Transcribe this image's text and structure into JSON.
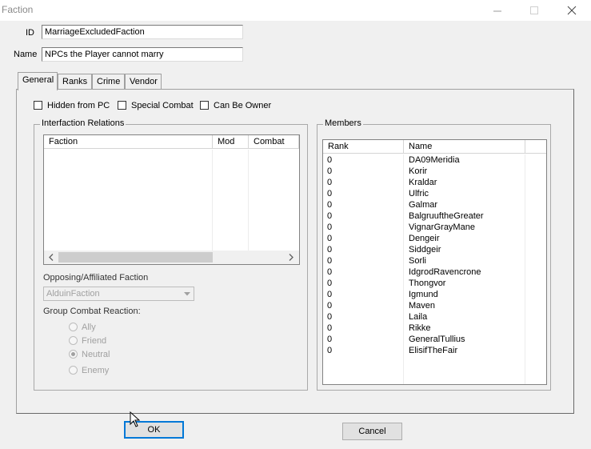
{
  "window": {
    "title": "Faction"
  },
  "fields": {
    "id_label": "ID",
    "id_value": "MarriageExcludedFaction",
    "name_label": "Name",
    "name_value": "NPCs the Player cannot marry"
  },
  "tabs": [
    {
      "label": "General",
      "active": true
    },
    {
      "label": "Ranks"
    },
    {
      "label": "Crime"
    },
    {
      "label": "Vendor"
    }
  ],
  "flags": {
    "hidden_from_pc": "Hidden from PC",
    "special_combat": "Special Combat",
    "can_be_owner": "Can Be Owner"
  },
  "interfaction": {
    "title": "Interfaction Relations",
    "columns": [
      "Faction",
      "Mod",
      "Combat"
    ]
  },
  "opposing": {
    "label": "Opposing/Affiliated Faction",
    "value": "AlduinFaction"
  },
  "group_combat": {
    "label": "Group Combat Reaction:",
    "options": [
      "Ally",
      "Friend",
      "Neutral",
      "Enemy"
    ],
    "selected": "Neutral"
  },
  "members": {
    "title": "Members",
    "columns": [
      "Rank",
      "Name"
    ],
    "rows": [
      {
        "rank": "0",
        "name": "DA09Meridia"
      },
      {
        "rank": "0",
        "name": "Korir"
      },
      {
        "rank": "0",
        "name": "Kraldar"
      },
      {
        "rank": "0",
        "name": "Ulfric"
      },
      {
        "rank": "0",
        "name": "Galmar"
      },
      {
        "rank": "0",
        "name": "BalgruuftheGreater"
      },
      {
        "rank": "0",
        "name": "VignarGrayMane"
      },
      {
        "rank": "0",
        "name": "Dengeir"
      },
      {
        "rank": "0",
        "name": "Siddgeir"
      },
      {
        "rank": "0",
        "name": "Sorli"
      },
      {
        "rank": "0",
        "name": "IdgrodRavencrone"
      },
      {
        "rank": "0",
        "name": "Thongvor"
      },
      {
        "rank": "0",
        "name": "Igmund"
      },
      {
        "rank": "0",
        "name": "Maven"
      },
      {
        "rank": "0",
        "name": "Laila"
      },
      {
        "rank": "0",
        "name": "Rikke"
      },
      {
        "rank": "0",
        "name": "GeneralTullius"
      },
      {
        "rank": "0",
        "name": "ElisifTheFair"
      }
    ]
  },
  "buttons": {
    "ok": "OK",
    "cancel": "Cancel"
  }
}
